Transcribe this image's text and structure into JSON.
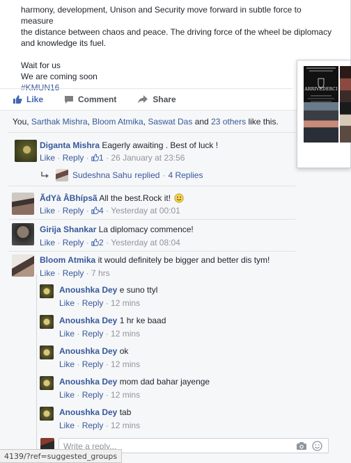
{
  "post": {
    "lines": [
      "harmony, development, Unison and Security move forward in subtle force to measure",
      "the distance between chaos and peace. The driving force of the wheel be diplomacy",
      "and knowledge its fuel."
    ],
    "closing": [
      "Wait for us",
      "We are coming soon"
    ],
    "hashtag": "#KMUN16"
  },
  "actions": {
    "like": "Like",
    "comment": "Comment",
    "share": "Share"
  },
  "likes_line": {
    "prefix": "You, ",
    "n1": "Sarthak Mishra",
    "n2": "Bloom Atmika",
    "n3": "Saswat Das",
    "and": " and ",
    "others": "23 others",
    "suffix": " like this."
  },
  "comments": [
    {
      "name": "Diganta Mishra",
      "text": " Eagerly awaiting . Best of luck !",
      "like": "Like",
      "reply": "Reply",
      "count": "1",
      "time": "26 January at 23:56"
    },
    {
      "name": "ÃdYà ÂBhípsã",
      "text": " All the best.Rock it!",
      "like": "Like",
      "reply": "Reply",
      "count": "4",
      "time": "Yesterday at 00:01"
    },
    {
      "name": "Girija Shankar",
      "text": " La diplomacy commence!",
      "like": "Like",
      "reply": "Reply",
      "count": "2",
      "time": "Yesterday at 08:04"
    },
    {
      "name": "Bloom Atmika",
      "text": " it would definitely be bigger and better dis tym!",
      "like": "Like",
      "reply": "Reply",
      "time": "7 hrs"
    }
  ],
  "reply_summary": {
    "name": "Sudeshna Sahu",
    "replied": "replied",
    "dot": "·",
    "count": "4 Replies"
  },
  "replies": [
    {
      "name": "Anoushka Dey",
      "text": " e suno ttyl",
      "like": "Like",
      "reply": "Reply",
      "time": "12 mins"
    },
    {
      "name": "Anoushka Dey",
      "text": " 1 hr ke baad",
      "like": "Like",
      "reply": "Reply",
      "time": "12 mins"
    },
    {
      "name": "Anoushka Dey",
      "text": " ok",
      "like": "Like",
      "reply": "Reply",
      "time": "12 mins"
    },
    {
      "name": "Anoushka Dey",
      "text": " mom dad bahar jayenge",
      "like": "Like",
      "reply": "Reply",
      "time": "12 mins"
    },
    {
      "name": "Anoushka Dey",
      "text": " tab",
      "like": "Like",
      "reply": "Reply",
      "time": "12 mins"
    }
  ],
  "write_reply": {
    "placeholder": "Write a reply..."
  },
  "popover": {
    "line1": "ARRIVEDERCI"
  },
  "status_bar": {
    "url": "4139/?ref=suggested_groups"
  },
  "meta": {
    "sep": " · "
  },
  "colors": {
    "link": "#365899",
    "accent": "#4267b2",
    "meta": "#90949c"
  }
}
